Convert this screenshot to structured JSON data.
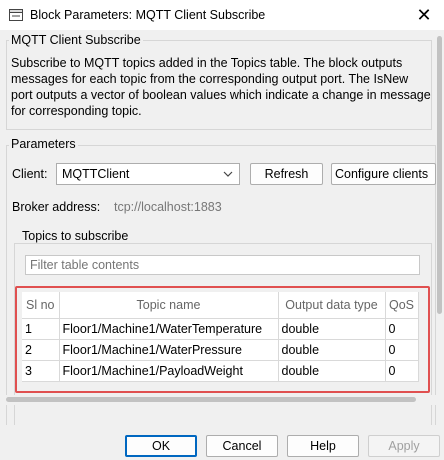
{
  "window": {
    "title": "Block Parameters: MQTT Client Subscribe",
    "close_glyph": "✕"
  },
  "block": {
    "name": "MQTT Client Subscribe",
    "description": "Subscribe to MQTT topics added in the Topics table. The block outputs messages for each topic from the corresponding output port. The IsNew port outputs a vector of boolean values which indicate a change in message for corresponding topic."
  },
  "parameters": {
    "heading": "Parameters",
    "client_label": "Client:",
    "client_value": "MQTTClient",
    "refresh_label": "Refresh",
    "configure_label": "Configure clients",
    "broker_label": "Broker address:",
    "broker_value": "tcp://localhost:1883"
  },
  "topics": {
    "heading": "Topics to subscribe",
    "filter_placeholder": "Filter table contents",
    "columns": [
      "Sl no",
      "Topic name",
      "Output data type",
      "QoS"
    ],
    "rows": [
      {
        "sl": "1",
        "topic": "Floor1/Machine1/WaterTemperature",
        "type": "double",
        "qos": "0"
      },
      {
        "sl": "2",
        "topic": "Floor1/Machine1/WaterPressure",
        "type": "double",
        "qos": "0"
      },
      {
        "sl": "3",
        "topic": "Floor1/Machine1/PayloadWeight",
        "type": "double",
        "qos": "0"
      }
    ]
  },
  "buttons": {
    "ok": "OK",
    "cancel": "Cancel",
    "help": "Help",
    "apply": "Apply"
  },
  "colors": {
    "highlight_border": "#e05050",
    "ok_border": "#0067c0",
    "disabled_text": "#a0a0a0"
  },
  "icons": {
    "app": "simulink-block-icon",
    "close": "close-icon",
    "dropdown": "chevron-down-icon"
  }
}
